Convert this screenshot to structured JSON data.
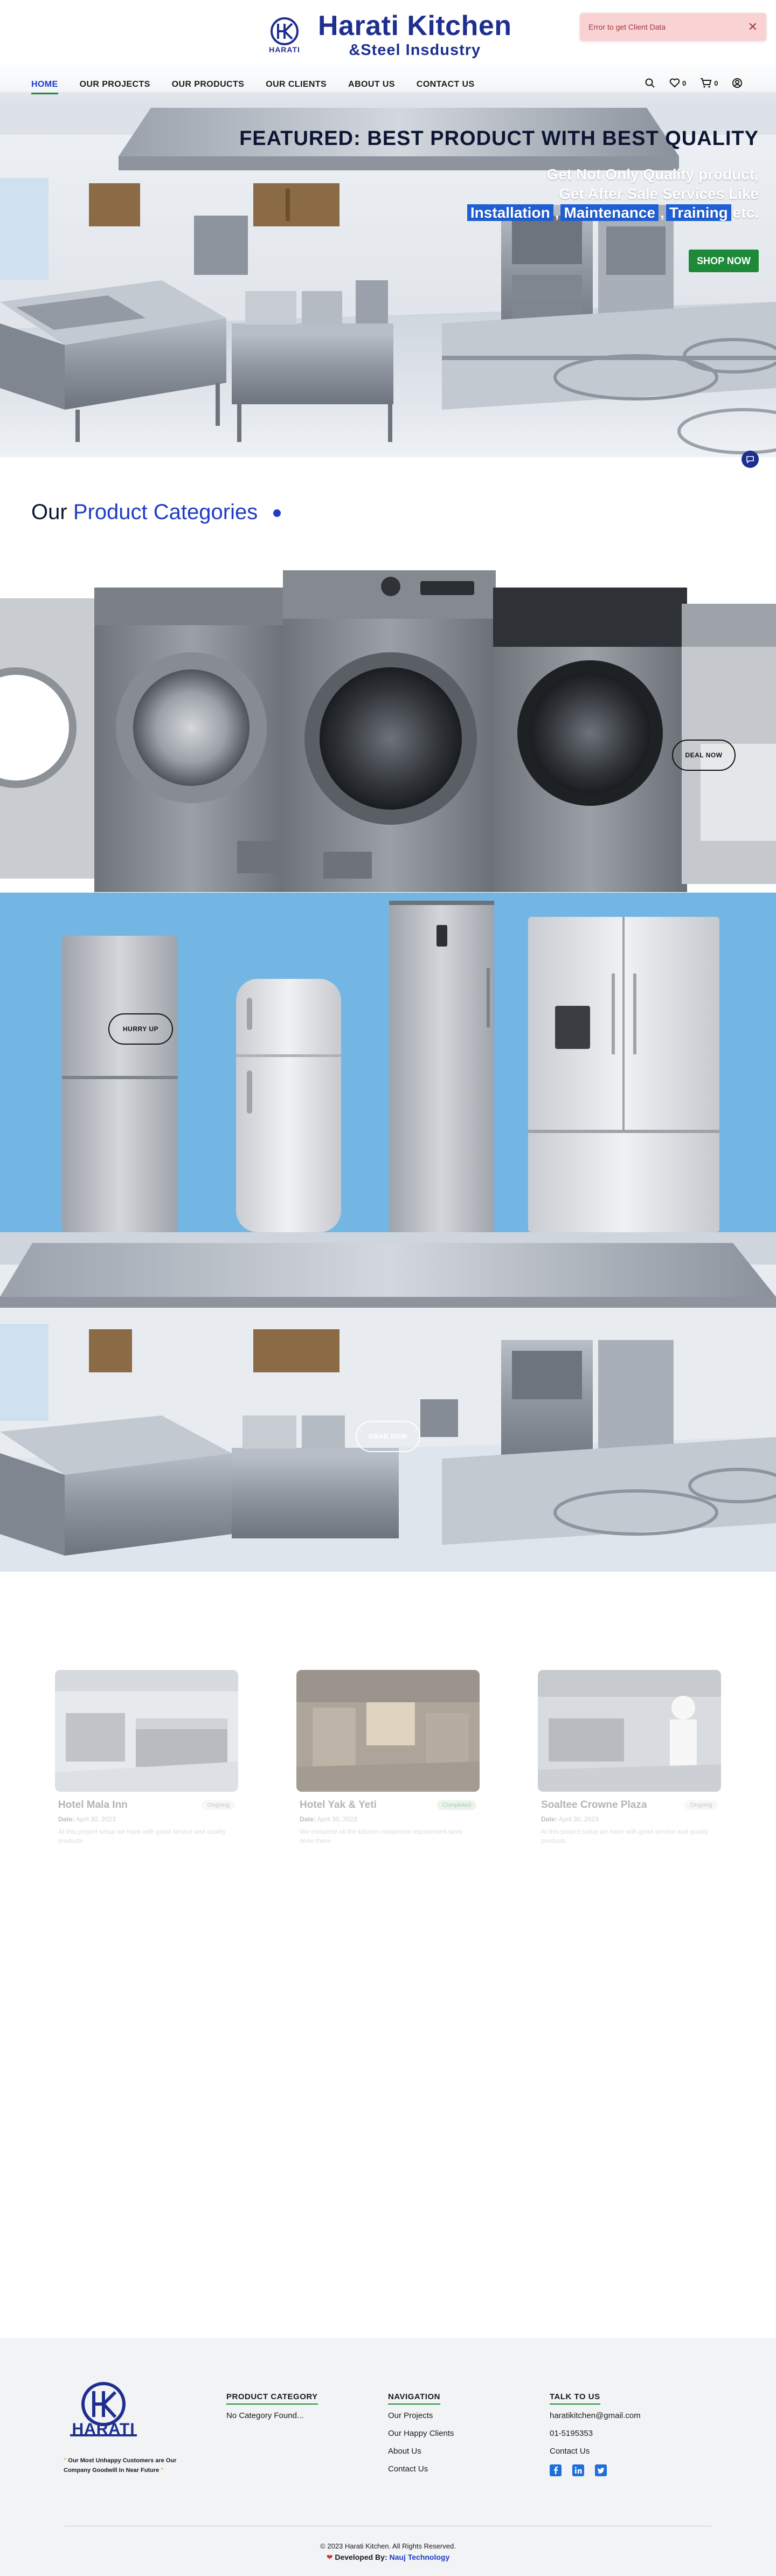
{
  "brand": {
    "title": "Harati Kitchen",
    "subtitle": "&Steel Insdustry",
    "logo_text": "HARATI",
    "logo_mark": "HK"
  },
  "toast": {
    "message": "Error to get Client Data",
    "close": "✕"
  },
  "nav": {
    "items": [
      {
        "label": "HOME",
        "active": true
      },
      {
        "label": "OUR PROJECTS",
        "active": false
      },
      {
        "label": "OUR PRODUCTS",
        "active": false
      },
      {
        "label": "OUR CLIENTS",
        "active": false
      },
      {
        "label": "ABOUT US",
        "active": false
      },
      {
        "label": "CONTACT US",
        "active": false
      }
    ],
    "wishlist_count": "0",
    "cart_count": "0",
    "icons": [
      "search-icon",
      "heart-icon",
      "cart-icon",
      "user-icon"
    ]
  },
  "hero": {
    "title": "FEATURED: BEST PRODUCT WITH BEST QUALITY",
    "line1": "Get Not Only Quality product,",
    "line2": "Get After Sale Services Like",
    "highlights": [
      "Installation",
      "Maintenance",
      "Training"
    ],
    "sep1": ",",
    "sep2": ",",
    "suffix": "etc.",
    "cta": "SHOP NOW"
  },
  "categories": {
    "title_prefix": "Our",
    "title_accent": "Product Categories",
    "banners": [
      {
        "button": "DEAL NOW"
      },
      {
        "button": "HURRY UP"
      },
      {
        "button": "GRAB NOW"
      }
    ]
  },
  "projects": [
    {
      "title": "Hotel Mala Inn",
      "status": "Ongoing",
      "date_label": "Date:",
      "date": "April 30, 2023",
      "desc": "At this project setup we have with good service and quality products"
    },
    {
      "title": "Hotel Yak & Yeti",
      "status": "Completed",
      "date_label": "Date:",
      "date": "April 30, 2023",
      "desc": "We complete all the kitchen equipment requirement work done there"
    },
    {
      "title": "Soaltee Crowne Plaza",
      "status": "Ongoing",
      "date_label": "Date:",
      "date": "April 30, 2023",
      "desc": "At this project setup we have with good service and quality products"
    }
  ],
  "footer": {
    "tagline_quote_open": "\"",
    "tagline": "Our Most Unhappy Customers are Our Company Goodwill In Near Future",
    "tagline_quote_close": "\"",
    "product_category": {
      "heading": "PRODUCT CATEGORY",
      "empty": "No Category Found..."
    },
    "navigation": {
      "heading": "NAVIGATION",
      "items": [
        "Our Projects",
        "Our Happy Clients",
        "About Us",
        "Contact Us"
      ]
    },
    "talk": {
      "heading": "TALK TO US",
      "email": "haratikitchen@gmail.com",
      "phone": "01-5195353",
      "contact": "Contact Us",
      "socials": [
        "facebook-icon",
        "linkedin-icon",
        "twitter-icon"
      ]
    },
    "copyright": "© 2023 Harati Kitchen. All Rights Reserved.",
    "developed_by": "Developed By:",
    "developer": "Nauj Technology"
  },
  "colors": {
    "brand_blue": "#1e2f8f",
    "accent_blue": "#1e3cc7",
    "green": "#1e8a39",
    "toast_bg": "#f9d2d4",
    "sky": "#74b6e3"
  }
}
